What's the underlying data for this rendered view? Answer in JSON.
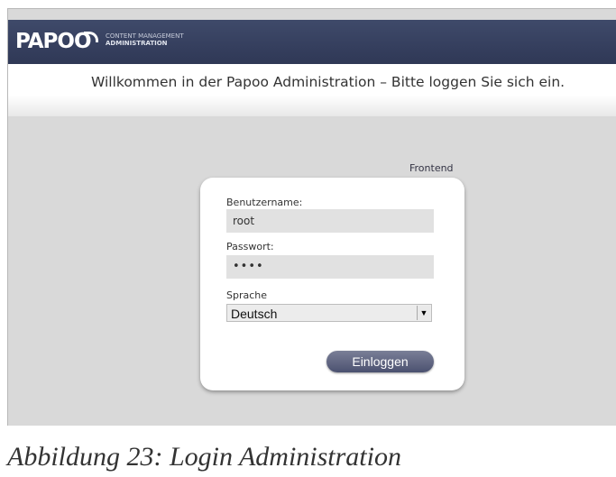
{
  "header": {
    "logo_text": "PAPOO",
    "tagline_line1": "CONTENT MANAGEMENT",
    "tagline_line2": "ADMINISTRATION",
    "bar_color": "#2f3856"
  },
  "welcome_text": "Willkommen in der Papoo Administration – Bitte loggen Sie sich ein.",
  "frontend_link": "Frontend",
  "login": {
    "username_label": "Benutzername:",
    "username_value": "root",
    "password_label": "Passwort:",
    "password_value": "••••",
    "language_label": "Sprache",
    "language_value": "Deutsch",
    "submit_label": "Einloggen"
  },
  "caption": "Abbildung 23: Login Administration"
}
